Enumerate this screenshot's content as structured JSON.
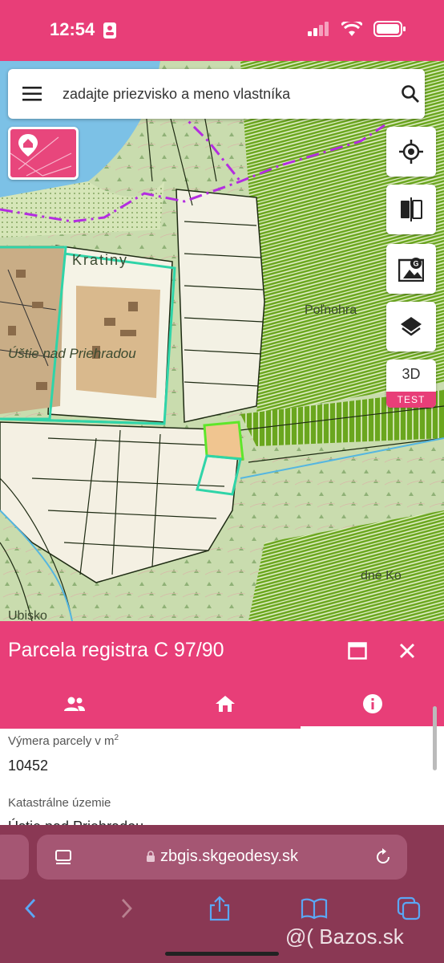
{
  "status": {
    "time": "12:54"
  },
  "search": {
    "placeholder": "zadajte priezvisko a meno vlastníka"
  },
  "map": {
    "labels": [
      {
        "text": "Kratiny"
      },
      {
        "text": "Úštie nad Priehradou"
      },
      {
        "text": "Poľnohra"
      },
      {
        "text": "dné Ko"
      },
      {
        "text": "Ubisko"
      }
    ]
  },
  "map_controls": {
    "btn_3d": "3D",
    "btn_3d_badge": "TEST"
  },
  "panel": {
    "title": "Parcela registra C 97/90",
    "fields": [
      {
        "label": "Výmera parcely v m",
        "label_sup": "2",
        "value": "10452"
      },
      {
        "label": "Katastrálne územie",
        "value": "Ústie nad Priehradou"
      }
    ]
  },
  "browser": {
    "url": "zbgis.skgeodesy.sk"
  },
  "watermark": "@( Bazos.sk",
  "colors": {
    "brand": "#e83e78",
    "browser": "#8a3854"
  }
}
